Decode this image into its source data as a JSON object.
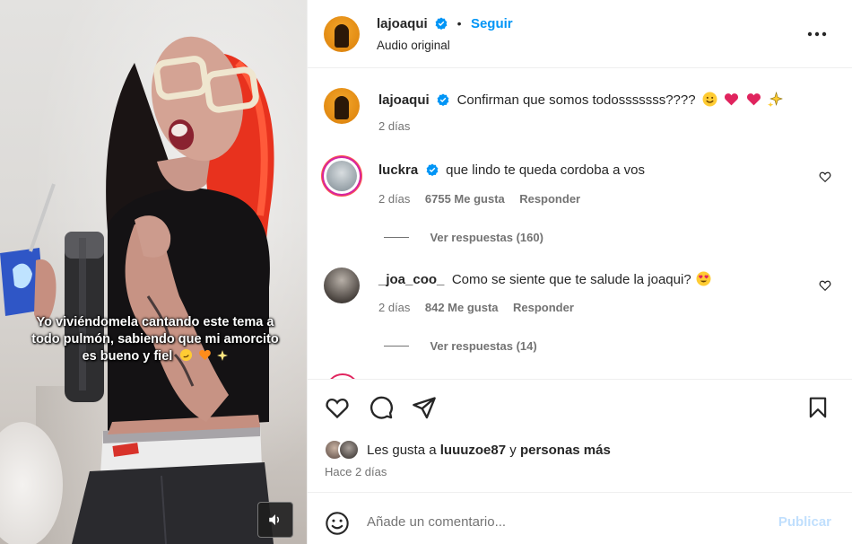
{
  "media": {
    "overlay_caption_lines": [
      "Yo viviéndomela cantando este tema a",
      "todo pulmón, sabiendo que mi amorcito",
      "es bueno y fiel"
    ],
    "audio_icon": "speaker-icon"
  },
  "header": {
    "username": "lajoaqui",
    "separator": "•",
    "follow_label": "Seguir",
    "subtitle": "Audio original",
    "more_icon": "more-options-icon"
  },
  "caption": {
    "username": "lajoaqui",
    "text": "Confirman que somos todosssssss????",
    "time": "2 días"
  },
  "comments": [
    {
      "username": "luckra",
      "verified": true,
      "text": "que lindo te queda cordoba a vos",
      "time": "2 días",
      "likes": "6755 Me gusta",
      "reply_label": "Responder",
      "view_replies": "Ver respuestas (160)"
    },
    {
      "username": "_joa_coo_",
      "verified": false,
      "text": "Como se siente que te salude la joaqui?",
      "time": "2 días",
      "likes": "842 Me gusta",
      "reply_label": "Responder",
      "view_replies": "Ver respuestas (14)"
    }
  ],
  "likes": {
    "prefix": "Les gusta a",
    "user": "luuuzoe87",
    "connector": "y",
    "others": "personas más",
    "posted": "Hace 2 días"
  },
  "add_comment": {
    "placeholder": "Añade un comentario...",
    "publish_label": "Publicar"
  },
  "colors": {
    "accent": "#0095f6",
    "text": "#262626",
    "muted": "#737373",
    "publish_disabled": "#c0dffd",
    "like_red": "#ff3040"
  }
}
